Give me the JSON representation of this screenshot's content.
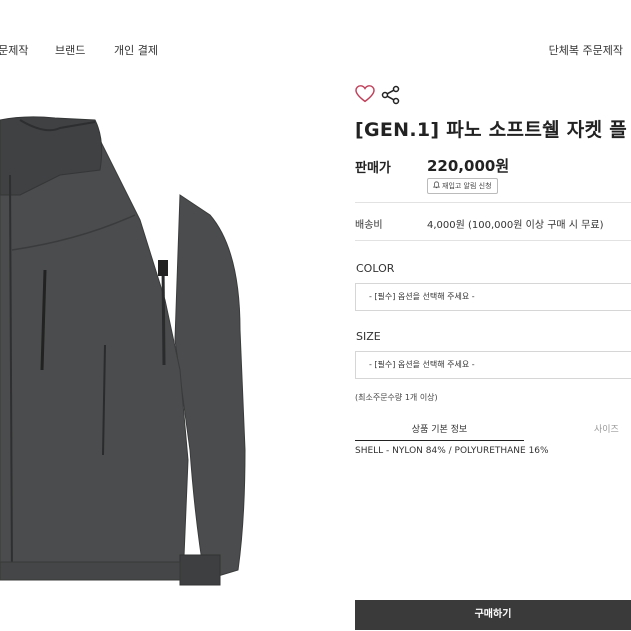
{
  "nav": {
    "items": [
      "주문제작",
      "브랜드",
      "개인 결제"
    ],
    "right_item": "단체복 주문제작"
  },
  "product": {
    "image_icon": "jacket-photo",
    "title": "[GEN.1] 파노 소프트쉘 자켓 플",
    "price_label": "판매가",
    "price": "220,000원",
    "restock_alert_button": "재입고 알림 신청",
    "shipping_label": "배송비",
    "shipping_value": "4,000원 (100,000원 이상 구매 시 무료)",
    "options": [
      {
        "label": "COLOR",
        "selected": "- [필수] 옵션을 선택해 주세요 -"
      },
      {
        "label": "SIZE",
        "selected": "- [필수] 옵션을 선택해 주세요 -"
      }
    ],
    "min_quantity_note": "(최소주문수량 1개 이상)",
    "tabs": [
      "상품 기본 정보",
      "사이즈"
    ],
    "spec": "SHELL - NYLON 84% / POLYURETHANE 16%",
    "buy_button": "구매하기"
  },
  "icons": {
    "heart": "heart-icon",
    "share": "share-icon",
    "bell": "bell-icon"
  },
  "colors": {
    "jacket": "#4a4c4d",
    "heart": "#c0405a",
    "buy_button": "#3a3a3a"
  }
}
